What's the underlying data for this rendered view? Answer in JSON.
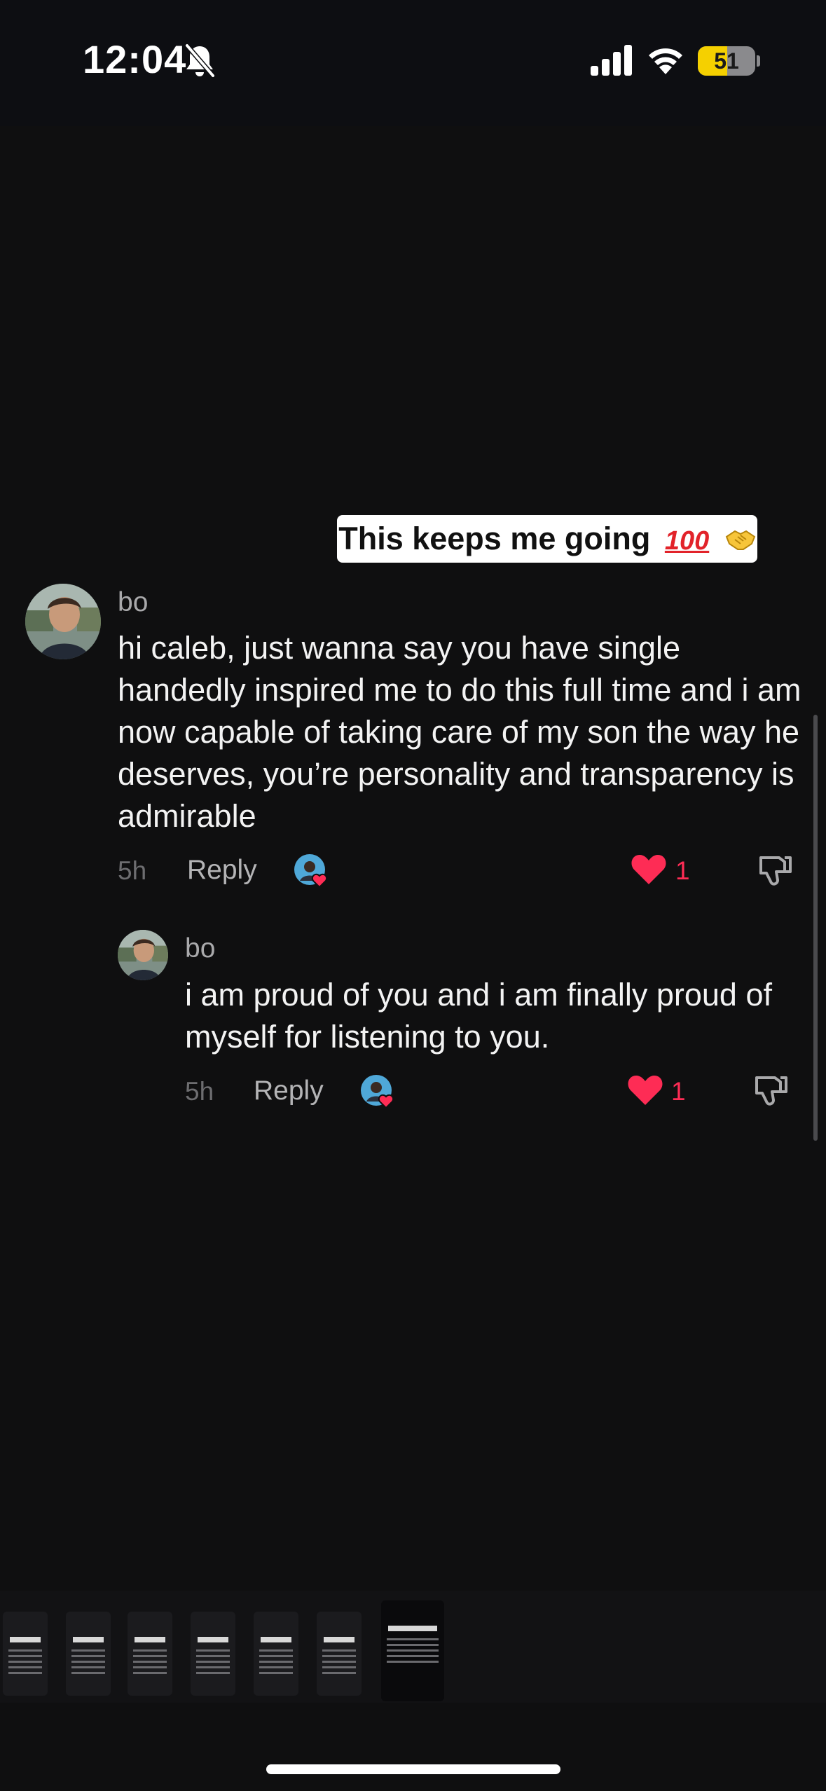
{
  "status_bar": {
    "time": "12:04",
    "battery": "51",
    "battery_level": 0.51,
    "icons": [
      "bell-slash-icon",
      "cellular-signal-icon",
      "wifi-icon",
      "battery-icon"
    ]
  },
  "caption": {
    "text": "This keeps me going",
    "emoji_1": "100-points-emoji",
    "emoji_2": "handshake-emoji"
  },
  "comments": [
    {
      "username": "bo",
      "text": "hi caleb, just wanna say you have single handedly inspired me to do this full time and i am now capable of taking care of my son the way he deserves, you’re personality and transparency is admirable",
      "time": "5h",
      "reply_label": "Reply",
      "like_count": "1",
      "creator_liked": true
    },
    {
      "username": "bo",
      "text": "i am proud of you and i am finally proud of myself for listening to you.",
      "time": "5h",
      "reply_label": "Reply",
      "like_count": "1",
      "creator_liked": true
    }
  ],
  "colors": {
    "background": "#0f0f10",
    "like_red": "#fe2c55",
    "battery_yellow": "#f5d000"
  },
  "thumbnails": {
    "count": 7,
    "active_index": 6
  }
}
